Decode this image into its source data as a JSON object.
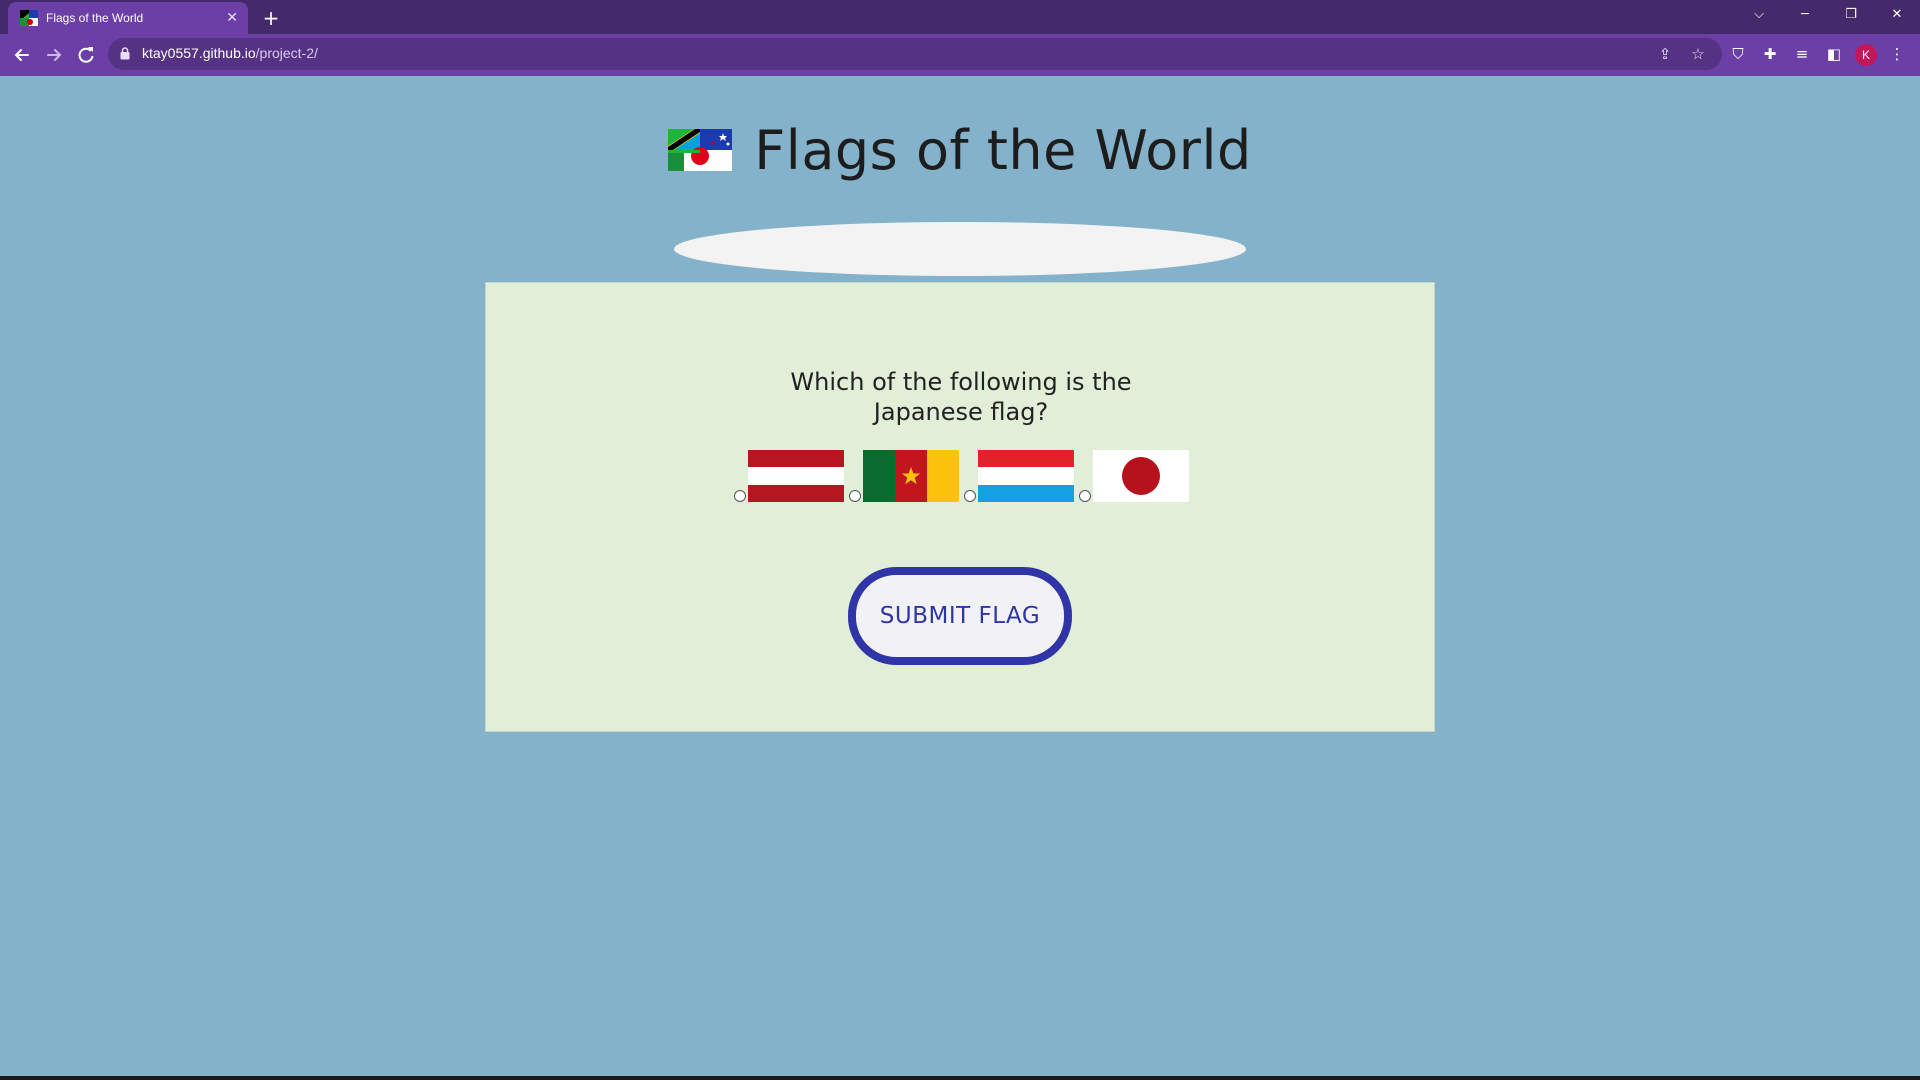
{
  "browser": {
    "tab_title": "Flags of the World",
    "tab_close": "✕",
    "new_tab": "+",
    "url_host": "ktay0557.github.io",
    "url_path": "/project-2/",
    "profile_initial": "K",
    "window_controls": {
      "tabsearch": "⌵",
      "minimize": "─",
      "restore": "❐",
      "close": "✕"
    }
  },
  "page": {
    "title": "Flags of the World",
    "question": "Which of the following is the Japanese flag?",
    "submit_label": "SUBMIT FLAG",
    "options": [
      {
        "flag": "austria",
        "icon": "austria-flag-icon"
      },
      {
        "flag": "cameroon",
        "icon": "cameroon-flag-icon"
      },
      {
        "flag": "luxembourg",
        "icon": "luxembourg-flag-icon"
      },
      {
        "flag": "japan",
        "icon": "japan-flag-icon"
      }
    ]
  },
  "colors": {
    "page_background": "#83b2ca",
    "card_background": "#e1eed8",
    "accent": "#2f35a6",
    "browser_frame": "#6b3fa6"
  }
}
